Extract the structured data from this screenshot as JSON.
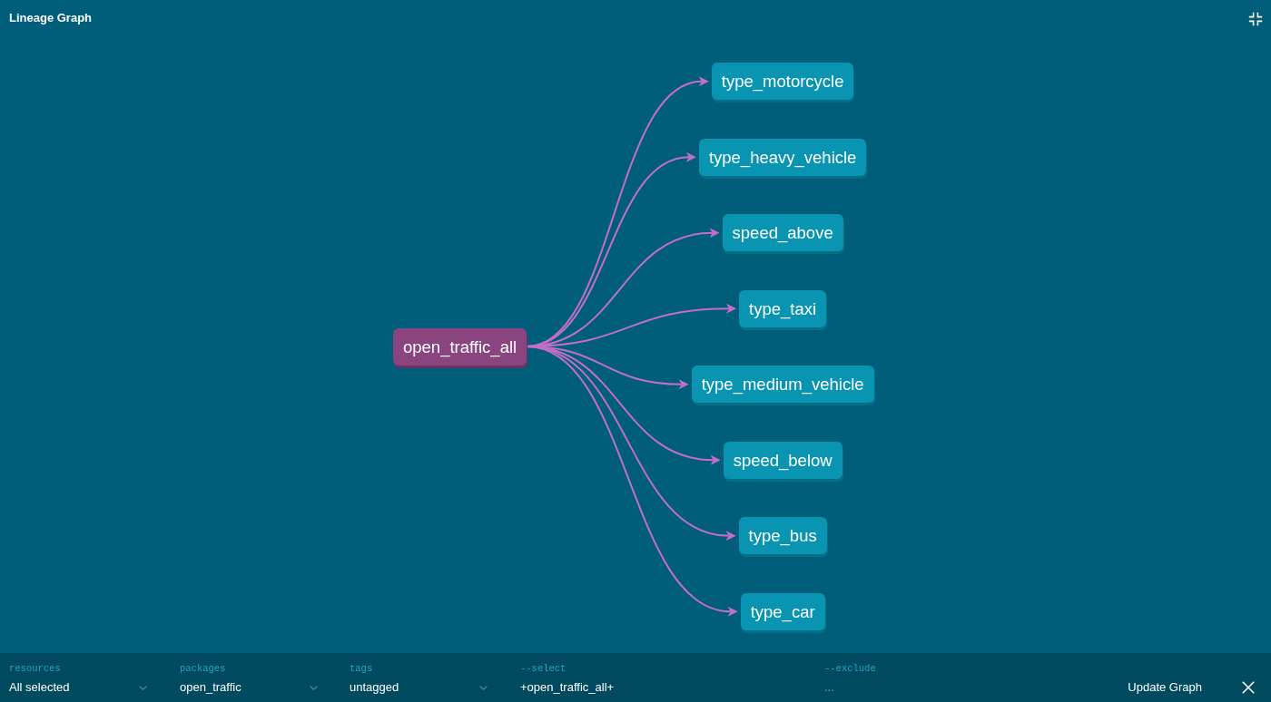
{
  "panel": {
    "title": "Lineage Graph"
  },
  "graph": {
    "nodes": [
      {
        "label": "open_traffic_all",
        "selected": true,
        "children": [
          {
            "label": "type_motorcycle",
            "selected": false
          },
          {
            "label": "type_heavy_vehicle",
            "selected": false
          },
          {
            "label": "speed_above",
            "selected": false
          },
          {
            "label": "type_taxi",
            "selected": false
          },
          {
            "label": "type_medium_vehicle",
            "selected": false
          },
          {
            "label": "speed_below",
            "selected": false
          },
          {
            "label": "type_bus",
            "selected": false
          },
          {
            "label": "type_car",
            "selected": false
          }
        ]
      }
    ]
  },
  "filters": [
    {
      "kind": "dropdown",
      "label": "resources",
      "value": "All selected"
    },
    {
      "kind": "dropdown",
      "label": "packages",
      "value": "open_traffic"
    },
    {
      "kind": "dropdown",
      "label": "tags",
      "value": "untagged"
    },
    {
      "kind": "input",
      "label": "--select",
      "value": "+open_traffic_all+"
    },
    {
      "kind": "input",
      "label": "--exclude",
      "placeholder": "..."
    }
  ],
  "actions": {
    "update_button": "Update Graph"
  }
}
